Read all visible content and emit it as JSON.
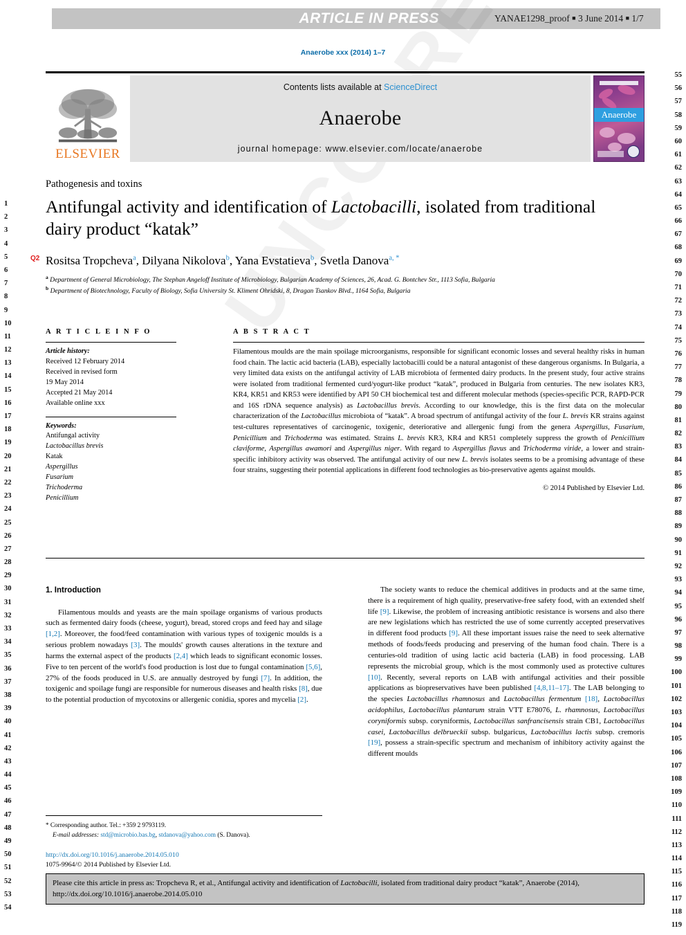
{
  "header": {
    "article_in_press": "ARTICLE IN PRESS",
    "proof_id": "YANAE1298_proof",
    "proof_date": "3 June 2014",
    "proof_page": "1/7",
    "journal_ref": "Anaerobe xxx (2014) 1–7"
  },
  "masthead": {
    "publisher": "ELSEVIER",
    "contents_prefix": "Contents lists available at ",
    "contents_link": "ScienceDirect",
    "journal_name": "Anaerobe",
    "homepage": "journal homepage: www.elsevier.com/locate/anaerobe",
    "cover_title": "Anaerobe"
  },
  "article": {
    "section_label": "Pathogenesis and toxins",
    "title_part1": "Antifungal activity and identification of ",
    "title_italic": "Lactobacilli",
    "title_part2": ", isolated from traditional dairy product “katak”",
    "query_tag": "Q2",
    "authors": [
      {
        "name": "Rositsa Tropcheva",
        "marks": "a"
      },
      {
        "name": "Dilyana Nikolova",
        "marks": "b"
      },
      {
        "name": "Yana Evstatieva",
        "marks": "b"
      },
      {
        "name": "Svetla Danova",
        "marks": "a, *"
      }
    ],
    "affiliations": [
      {
        "mark": "a",
        "text": "Department of General Microbiology, The Stephan Angeloff Institute of Microbiology, Bulgarian Academy of Sciences, 26, Acad. G. Bontchev Str., 1113 Sofia, Bulgaria"
      },
      {
        "mark": "b",
        "text": "Department of Biotechnology, Faculty of Biology, Sofia University St. Kliment Ohridski, 8, Dragan Tsankov Blvd., 1164 Sofia, Bulgaria"
      }
    ]
  },
  "panel": {
    "info_heading": "A R T I C L E  I N F O",
    "abstract_heading": "A B S T R A C T",
    "history_title": "Article history:",
    "history_lines": [
      "Received 12 February 2014",
      "Received in revised form",
      "19 May 2014",
      "Accepted 21 May 2014",
      "Available online xxx"
    ],
    "keywords_title": "Keywords:",
    "keywords": [
      {
        "text": "Antifungal activity",
        "italic": false
      },
      {
        "text": "Lactobacillus brevis",
        "italic": true
      },
      {
        "text": "Katak",
        "italic": false
      },
      {
        "text": "Aspergillus",
        "italic": true
      },
      {
        "text": "Fusarium",
        "italic": true
      },
      {
        "text": "Trichoderma",
        "italic": true
      },
      {
        "text": "Penicillium",
        "italic": true
      }
    ],
    "abstract_html": "Filamentous moulds are the main spoilage microorganisms, responsible for significant economic losses and several healthy risks in human food chain. The lactic acid bacteria (LAB), especially lactobacilli could be a natural antagonist of these dangerous organisms. In Bulgaria, a very limited data exists on the antifungal activity of LAB microbiota of fermented dairy products. In the present study, four active strains were isolated from traditional fermented curd/yogurt-like product “katak”, produced in Bulgaria from centuries. The new isolates KR3, KR4, KR51 and KR53 were identified by API 50 CH biochemical test and different molecular methods (species-specific PCR, RAPD-PCR and 16S rDNA sequence analysis) as <i>Lactobacillus brevis</i>. According to our knowledge, this is the first data on the molecular characterization of the <i>Lactobacillus</i> microbiota of “katak”. A broad spectrum of antifungal activity of the four <i>L. brevis</i> KR strains against test-cultures representatives of carcinogenic, toxigenic, deteriorative and allergenic fungi from the genera <i>Aspergillus</i>, <i>Fusarium</i>, <i>Penicillium</i> and <i>Trichoderma</i> was estimated. Strains <i>L. brevis</i> KR3, KR4 and KR51 completely suppress the growth of <i>Penicillium claviforme</i>, <i>Aspergillus awamori</i> and <i>Aspergillus niger</i>. With regard to <i>Aspergillus flavus</i> and <i>Trichoderma viride</i>, a lower and strain-specific inhibitory activity was observed. The antifungal activity of our new <i>L. brevis</i> isolates seems to be a promising advantage of these four strains, suggesting their potential applications in different food technologies as bio-preservative agents against moulds.",
    "copyright": "© 2014 Published by Elsevier Ltd."
  },
  "body": {
    "intro_heading": "1. Introduction",
    "left_paragraph_html": "Filamentous moulds and yeasts are the main spoilage organisms of various products such as fermented dairy foods (cheese, yogurt), bread, stored crops and feed hay and silage <span class=\"ref\">[1,2]</span>. Moreover, the food/feed contamination with various types of toxigenic moulds is a serious problem nowadays <span class=\"ref\">[3]</span>. The moulds' growth causes alterations in the texture and harms the external aspect of the products <span class=\"ref\">[2,4]</span> which leads to significant economic losses. Five to ten percent of the world's food production is lost due to fungal contamination <span class=\"ref\">[5,6]</span>, 27% of the foods produced in U.S. are annually destroyed by fungi <span class=\"ref\">[7]</span>. In addition, the toxigenic and spoilage fungi are responsible for numerous diseases and health risks <span class=\"ref\">[8]</span>, due to the potential production of mycotoxins or allergenic conidia, spores and mycelia <span class=\"ref\">[2]</span>.",
    "right_paragraph_html": "The society wants to reduce the chemical additives in products and at the same time, there is a requirement of high quality, preservative-free safety food, with an extended shelf life <span class=\"ref\">[9]</span>. Likewise, the problem of increasing antibiotic resistance is worsens and also there are new legislations which has restricted the use of some currently accepted preservatives in different food products <span class=\"ref\">[9]</span>. All these important issues raise the need to seek alternative methods of foods/feeds producing and preserving of the human food chain. There is a centuries-old tradition of using lactic acid bacteria (LAB) in food processing. LAB represents the microbial group, which is the most commonly used as protective cultures <span class=\"ref\">[10]</span>. Recently, several reports on LAB with antifungal activities and their possible applications as biopreservatives have been published <span class=\"ref\">[4,8,11–17]</span>. The LAB belonging to the species <i>Lactobacillus rhamnosus</i> and <i>Lactobacillus fermentum</i> <span class=\"ref\">[18]</span>, <i>Lactobacillus acidophilus</i>, <i>Lactobacillus plantarum</i> strain VTT E78076, <i>L. rhamnosus</i>, <i>Lactobacillus coryniformis</i> subsp. coryniformis, <i>Lactobacillus sanfrancisensis</i> strain CB1, <i>Lactobacillus casei</i>, <i>Lactobacillus delbrueckii</i> subsp. bulgaricus, <i>Lactobacillus lactis</i> subsp. cremoris <span class=\"ref\">[19]</span>, possess a strain-specific spectrum and mechanism of inhibitory activity against the different moulds"
  },
  "footer": {
    "corresponding_star": "*",
    "corresponding_text": "Corresponding author. Tel.: +359 2 9793119.",
    "email_label": "E-mail addresses:",
    "email1": "std@microbio.bas.bg",
    "email2": "stdanova@yahoo.com",
    "email_suffix": "(S. Danova).",
    "doi_url": "http://dx.doi.org/10.1016/j.anaerobe.2014.05.010",
    "issn_line": "1075-9964/© 2014 Published by Elsevier Ltd.",
    "cite_html": "Please cite this article in press as: Tropcheva R, et al., Antifungal activity and identification of <i>Lactobacilli</i>, isolated from traditional dairy product “katak”, Anaerobe (2014), http://dx.doi.org/10.1016/j.anaerobe.2014.05.010"
  },
  "line_numbers": {
    "left_start": 1,
    "left_end": 54,
    "right_start": 55,
    "right_end": 119
  },
  "watermark": "UNCORRECTED PROOF",
  "colors": {
    "link": "#1578b4",
    "elsevier_orange": "#e87722",
    "banner_grey": "#c3c3c3",
    "masthead_grey": "#e2e2e2",
    "query_red": "#e01b1b"
  }
}
